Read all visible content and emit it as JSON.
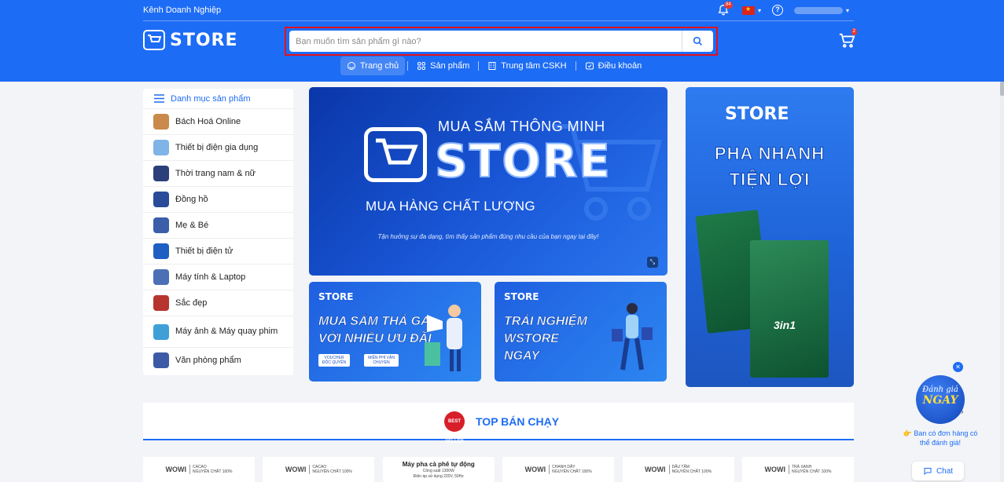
{
  "topbar": {
    "business_link": "Kênh Doanh Nghiệp",
    "notification_count": "84",
    "user_name": ""
  },
  "brand": {
    "logo_text": "STORE"
  },
  "search": {
    "placeholder": "Bạn muốn tìm sản phẩm gì nào?"
  },
  "cart": {
    "count": "2"
  },
  "nav": {
    "items": [
      {
        "label": "Trang chủ",
        "icon": "home-icon",
        "active": true
      },
      {
        "label": "Sản phẩm",
        "icon": "grid-icon"
      },
      {
        "label": "Trung tâm CSKH",
        "icon": "building-icon"
      },
      {
        "label": "Điều khoản",
        "icon": "terms-icon"
      }
    ]
  },
  "sidebar": {
    "title": "Danh mục sản phẩm",
    "categories": [
      {
        "label": "Bách Hoá Online",
        "color": "#c98a4b"
      },
      {
        "label": "Thiết bị điện gia dụng",
        "color": "#7fb4e6"
      },
      {
        "label": "Thời trang nam & nữ",
        "color": "#2b3f7a"
      },
      {
        "label": "Đồng hồ",
        "color": "#2a4b9a"
      },
      {
        "label": "Mẹ & Bé",
        "color": "#3a5ea8"
      },
      {
        "label": "Thiết bị điện tử",
        "color": "#1f5fc4"
      },
      {
        "label": "Máy tính & Laptop",
        "color": "#4c6fb5"
      },
      {
        "label": "Sắc đẹp",
        "color": "#b8352f"
      },
      {
        "label": "Máy ảnh & Máy quay phim",
        "color": "#3fa0d8"
      },
      {
        "label": "Văn phòng phẩm",
        "color": "#3d5aa6"
      }
    ]
  },
  "hero": {
    "headline": "MUA SẮM THÔNG MINH",
    "brand": "STORE",
    "subline": "MUA HÀNG CHẤT LƯỢNG",
    "tagline": "Tận hưởng sự đa dạng, tìm thấy sản phẩm đúng nhu cầu của bạn ngay tại đây!"
  },
  "promo1": {
    "logo": "STORE",
    "line1": "MUA SẮM THẢ GA",
    "line2": "VỚI NHIỀU ƯU ĐÃI",
    "chip1": "VOUCHER ĐỘC QUYỀN",
    "chip2": "MIỄN PHÍ VẬN CHUYỂN"
  },
  "promo2": {
    "logo": "STORE",
    "line1": "TRẢI NGHIỆM",
    "line2": "WSTORE",
    "line3": "NGAY"
  },
  "side_banner": {
    "logo": "STORE",
    "line1": "PHA NHANH",
    "line2": "TIỆN LỢI",
    "box_label": "3in1"
  },
  "top_selling": {
    "badge": "BEST SELLER",
    "title": "TOP BÁN CHẠY"
  },
  "products": [
    {
      "brand": "WOWI",
      "name1": "CACAO",
      "name2": "NGUYÊN CHẤT 100%"
    },
    {
      "brand": "WOWI",
      "name1": "CACAO",
      "name2": "NGUYÊN CHẤT 100%"
    },
    {
      "title": "Máy pha cà phê tự động",
      "spec1": "Công suất 1300W",
      "spec2": "Điện áp sử dụng 220V, 50Hz"
    },
    {
      "brand": "WOWI",
      "name1": "CHANH DÂY",
      "name2": "NGUYÊN CHẤT 100%"
    },
    {
      "brand": "WOWI",
      "name1": "DÂU TẰM",
      "name2": "NGUYÊN CHẤT 100%"
    },
    {
      "brand": "WOWI",
      "name1": "TRÀ XANH",
      "name2": "NGUYÊN CHẤT 100%"
    }
  ],
  "rating_widget": {
    "line1": "Đánh giá",
    "line2": "NGAY",
    "prompt": "Ban có đơn hàng có thể đánh giá!"
  },
  "chat": {
    "label": "Chat"
  }
}
